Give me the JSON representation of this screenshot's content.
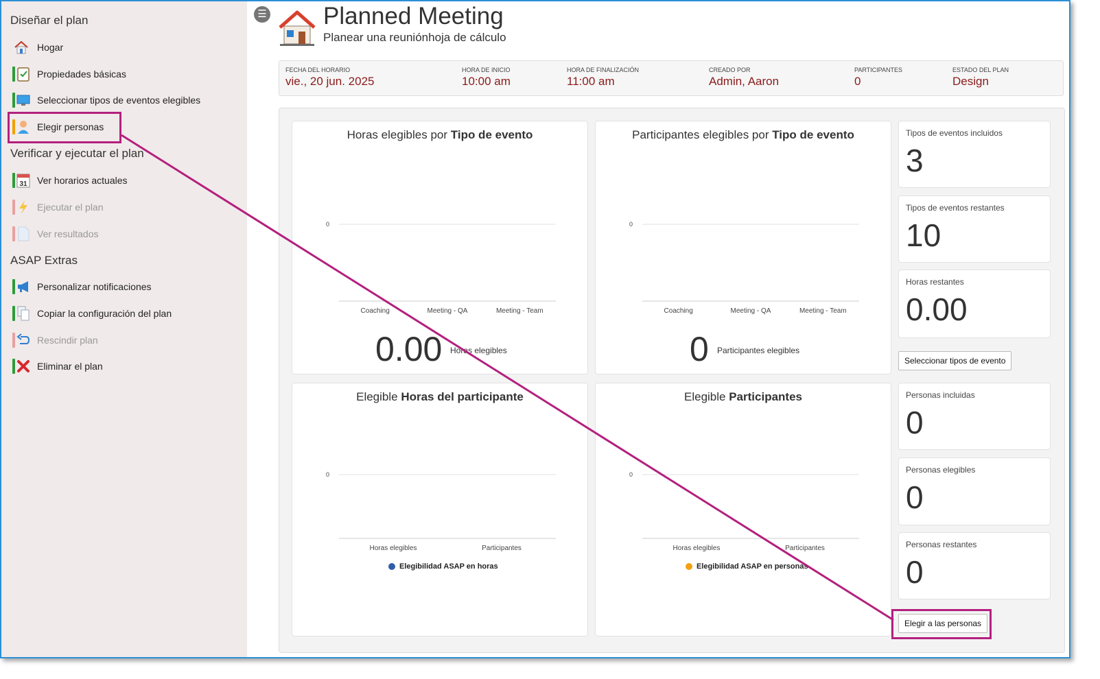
{
  "sidebar": {
    "sections": [
      {
        "title": "Diseñar el plan"
      },
      {
        "title": "Verificar y ejecutar el plan"
      },
      {
        "title": "ASAP Extras"
      }
    ],
    "items": [
      {
        "label": "Hogar",
        "icon": "home-icon"
      },
      {
        "label": "Propiedades básicas",
        "icon": "clipboard-check-icon"
      },
      {
        "label": "Seleccionar tipos de eventos elegibles",
        "icon": "monitor-icon"
      },
      {
        "label": "Elegir personas",
        "icon": "person-icon"
      },
      {
        "label": "Ver horarios actuales",
        "icon": "calendar-icon",
        "calendar_day": "31"
      },
      {
        "label": "Ejecutar el plan",
        "icon": "lightning-icon"
      },
      {
        "label": "Ver resultados",
        "icon": "document-icon"
      },
      {
        "label": "Personalizar notificaciones",
        "icon": "megaphone-icon"
      },
      {
        "label": "Copiar la configuración del plan",
        "icon": "copy-icon"
      },
      {
        "label": "Rescindir plan",
        "icon": "undo-arrow-icon"
      },
      {
        "label": "Eliminar el plan",
        "icon": "red-x-icon"
      }
    ]
  },
  "header": {
    "title": "Planned Meeting",
    "subtitle": "Planear una reuniónhoja de cálculo"
  },
  "info": {
    "date_label": "Fecha del horario",
    "date_value": "vie., 20 jun. 2025",
    "start_label": "Hora de inicio",
    "start_value": "10:00 am",
    "end_label": "Hora de finalización",
    "end_value": "11:00 am",
    "creator_label": "Creado por",
    "creator_value": "Admin, Aaron",
    "participants_label": "Participantes",
    "participants_value": "0",
    "status_label": "Estado del plan",
    "status_value": "Design"
  },
  "cards": {
    "hours_by_type": {
      "title_plain": "Horas elegibles por ",
      "title_bold": "Tipo de evento",
      "big_value": "0.00",
      "big_label": "Horas elegibles"
    },
    "participants_by_type": {
      "title_plain": "Participantes elegibles por ",
      "title_bold": "Tipo de evento",
      "big_value": "0",
      "big_label": "Participantes elegibles"
    },
    "participant_hours": {
      "title_plain": "Elegible ",
      "title_bold": "Horas del participante",
      "legend": "Elegibilidad ASAP en horas"
    },
    "participants": {
      "title_plain": "Elegible ",
      "title_bold": "Participantes",
      "legend": "Elegibilidad ASAP en personas"
    }
  },
  "stats": {
    "included_types_label": "Tipos de eventos incluidos",
    "included_types_value": "3",
    "remaining_types_label": "Tipos de eventos restantes",
    "remaining_types_value": "10",
    "remaining_hours_label": "Horas restantes",
    "remaining_hours_value": "0.00",
    "select_types_button": "Seleccionar tipos de evento",
    "included_people_label": "Personas incluidas",
    "included_people_value": "0",
    "eligible_people_label": "Personas elegibles",
    "eligible_people_value": "0",
    "remaining_people_label": "Personas restantes",
    "remaining_people_value": "0",
    "choose_people_button": "Elegir a las personas"
  },
  "colors": {
    "accent_value": "#8b1a1a",
    "highlight": "#b3207e",
    "series_hours": "#2e5eaa",
    "series_people": "#f5a00f"
  },
  "chart_data": [
    {
      "type": "bar",
      "categories": [
        "Coaching",
        "Meeting - QA",
        "Meeting - Team"
      ],
      "values": [
        0,
        0,
        0
      ],
      "yticks": [
        0
      ]
    },
    {
      "type": "bar",
      "categories": [
        "Coaching",
        "Meeting - QA",
        "Meeting - Team"
      ],
      "values": [
        0,
        0,
        0
      ],
      "yticks": [
        0
      ]
    },
    {
      "type": "bar",
      "categories": [
        "Horas elegibles",
        "Participantes"
      ],
      "series": [
        {
          "name": "Elegibilidad ASAP en horas",
          "values": [
            0,
            0
          ]
        }
      ],
      "yticks": [
        0
      ]
    },
    {
      "type": "bar",
      "categories": [
        "Horas elegibles",
        "Participantes"
      ],
      "series": [
        {
          "name": "Elegibilidad ASAP en personas",
          "values": [
            0,
            0
          ]
        }
      ],
      "yticks": [
        0
      ]
    }
  ]
}
